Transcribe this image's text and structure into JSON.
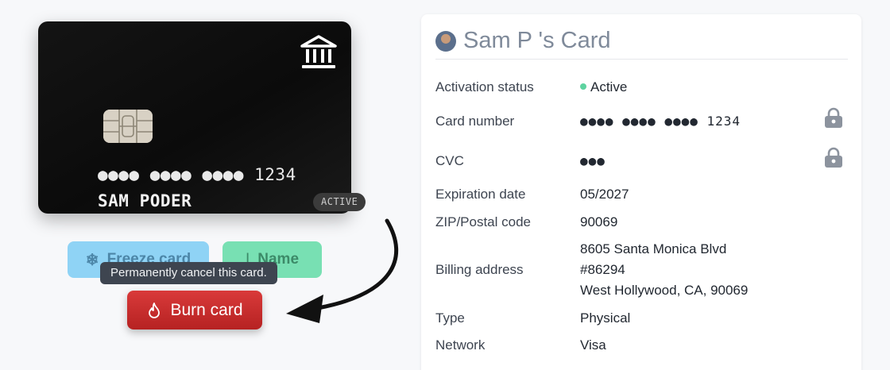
{
  "card": {
    "number": "●●●● ●●●● ●●●● 1234",
    "holder": "SAM PODER",
    "status_badge": "ACTIVE",
    "icons": {
      "bank": "bank-icon",
      "chip": "chip-icon"
    }
  },
  "actions": {
    "freeze_label": "Freeze card",
    "name_label": "Name",
    "burn_label": "Burn card",
    "burn_tooltip": "Permanently cancel this card.",
    "icons": {
      "freeze": "snowflake-icon",
      "name": "text-cursor-icon",
      "burn": "flame-icon"
    }
  },
  "panel": {
    "title": "Sam P 's Card",
    "rows": {
      "activation_status": {
        "label": "Activation status",
        "value": "Active"
      },
      "card_number": {
        "label": "Card number",
        "value": "●●●● ●●●● ●●●● 1234"
      },
      "cvc": {
        "label": "CVC",
        "value": "●●●"
      },
      "expiration": {
        "label": "Expiration date",
        "value": "05/2027"
      },
      "zip": {
        "label": "ZIP/Postal code",
        "value": "90069"
      },
      "billing": {
        "label": "Billing address",
        "lines": [
          "8605 Santa Monica Blvd",
          "#86294",
          "West Hollywood, CA, 90069"
        ]
      },
      "type": {
        "label": "Type",
        "value": "Physical"
      },
      "network": {
        "label": "Network",
        "value": "Visa"
      }
    }
  },
  "colors": {
    "burn": "#c62d2d",
    "freeze": "#8fd3f5",
    "name": "#78e0b3",
    "active_dot": "#5ed3a0"
  }
}
